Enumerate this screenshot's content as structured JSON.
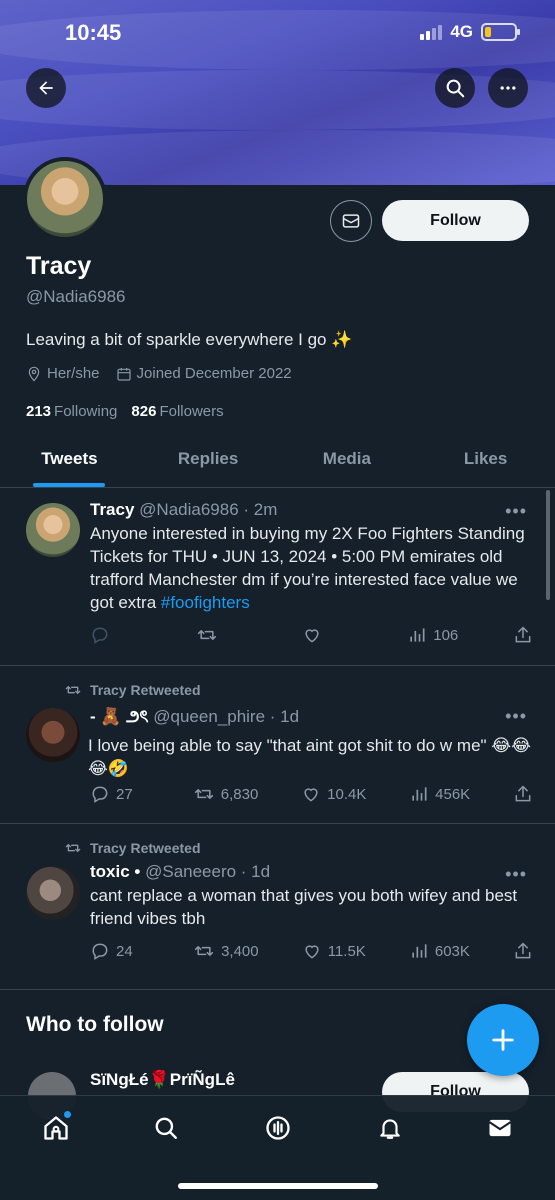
{
  "status_bar": {
    "time": "10:45",
    "network": "4G",
    "battery_level": 0.22
  },
  "header": {
    "back_icon": "back-arrow-icon",
    "search_icon": "search-icon",
    "more_icon": "more-icon"
  },
  "profile": {
    "name": "Tracy",
    "handle": "@Nadia6986",
    "bio": "Leaving a bit of sparkle everywhere I go ✨",
    "pronouns": "Her/she",
    "joined": "Joined December 2022",
    "following_count": "213",
    "following_label": "Following",
    "followers_count": "826",
    "followers_label": "Followers",
    "follow_label": "Follow"
  },
  "tabs": [
    {
      "label": "Tweets",
      "active": true
    },
    {
      "label": "Replies",
      "active": false
    },
    {
      "label": "Media",
      "active": false
    },
    {
      "label": "Likes",
      "active": false
    }
  ],
  "tweets": [
    {
      "name": "Tracy",
      "meta": "@Nadia6986 · 2m",
      "text": "Anyone interested in buying my 2X Foo Fighters Standing Tickets for THU • JUN 13, 2024 • 5:00 PM emirates old trafford Manchester dm if you’re interested face value we got extra ",
      "hashtag": "#foofighters",
      "replies": "",
      "retweets": "",
      "likes": "",
      "views": "106"
    },
    {
      "retweet_label": "Tracy Retweeted",
      "name": "- 🧸 ౨ৎ",
      "meta": "@queen_phire · 1d",
      "text": "I love being able to say \"that aint got shit to do w me\" 😂😂😂🤣",
      "replies": "27",
      "retweets": "6,830",
      "likes": "10.4K",
      "views": "456K"
    },
    {
      "retweet_label": "Tracy Retweeted",
      "name": "toxic •",
      "meta": "@Saneeero · 1d",
      "text": "cant replace a woman that gives you both wifey and best friend vibes tbh",
      "replies": "24",
      "retweets": "3,400",
      "likes": "11.5K",
      "views": "603K"
    }
  ],
  "who_to_follow": {
    "title": "Who to follow",
    "user_name": "SïNgŁé🌹PrïÑgLê",
    "follow_label": "Follow"
  },
  "colors": {
    "accent": "#1d9bf0",
    "background": "#15202b",
    "muted": "#8b98a5"
  }
}
